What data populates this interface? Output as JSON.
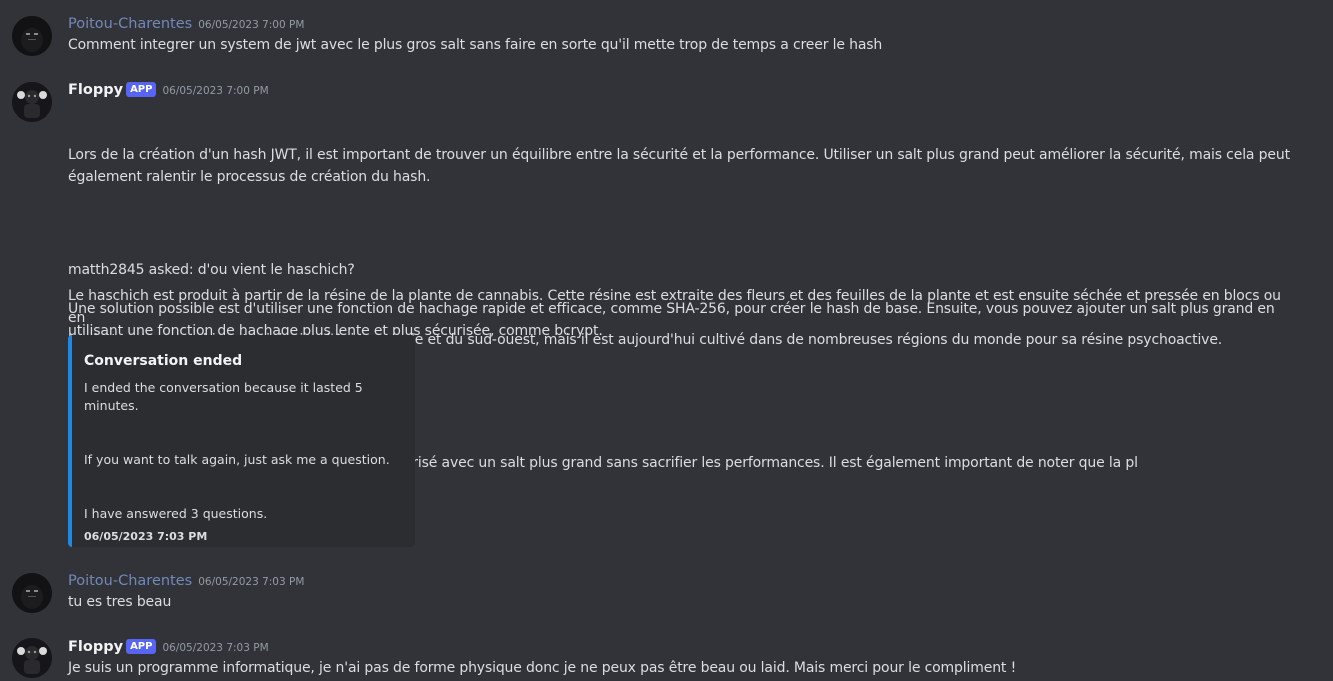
{
  "messages": [
    {
      "author": "Poitou-Charentes",
      "timestamp": "06/05/2023 7:00 PM",
      "lines": [
        "Comment integrer un system de jwt avec le plus gros salt sans faire en sorte qu'il mette trop de temps a creer le hash"
      ]
    },
    {
      "author": "Floppy",
      "badge": "APP",
      "timestamp": "06/05/2023 7:00 PM",
      "paragraphs": [
        "Lors de la création d'un hash JWT, il est important de trouver un équilibre entre la sécurité et la performance. Utiliser un salt plus grand peut améliorer la sécurité, mais cela peut\négalement ralentir le processus de création du hash.",
        "Une solution possible est d'utiliser une fonction de hachage rapide et efficace, comme SHA-256, pour créer le hash de base. Ensuite, vous pouvez ajouter un salt plus grand en\nutilisant une fonction de hachage plus lente et plus sécurisée, comme bcrypt.",
        "De cette façon, vous pouvez obtenir un hash sécurisé avec un salt plus grand sans sacrifier les performances. Il est également important de noter que la pl"
      ],
      "followup_question": "matth2845 asked: d'ou vient le haschich?",
      "followup_answer": "Le haschich est produit à partir de la résine de la plante de cannabis. Cette résine est extraite des fleurs et des feuilles de la plante et est ensuite séchée et pressée en blocs ou en\nboulettes. Le cannabis est originaire d'Asie centrale et du sud-ouest, mais il est aujourd'hui cultivé dans de nombreuses régions du monde pour sa résine psychoactive.",
      "embed": {
        "title": "Conversation ended",
        "line1": "I ended the conversation because it lasted 5 minutes.",
        "line2": "If you want to talk again, just ask me a question.",
        "line3": "I have answered 3 questions.",
        "timestamp": "06/05/2023 7:03 PM",
        "accent_color": "#1e88e5"
      }
    },
    {
      "author": "Poitou-Charentes",
      "timestamp": "06/05/2023 7:03 PM",
      "lines": [
        "tu es tres beau"
      ]
    },
    {
      "author": "Floppy",
      "badge": "APP",
      "timestamp": "06/05/2023 7:03 PM",
      "lines": [
        "Je suis un programme informatique, je n'ai pas de forme physique donc je ne peux pas être beau ou laid. Mais merci pour le compliment !"
      ]
    }
  ],
  "colors": {
    "background": "#313338",
    "user_name": "#7289b8",
    "badge": "#5865f2"
  }
}
